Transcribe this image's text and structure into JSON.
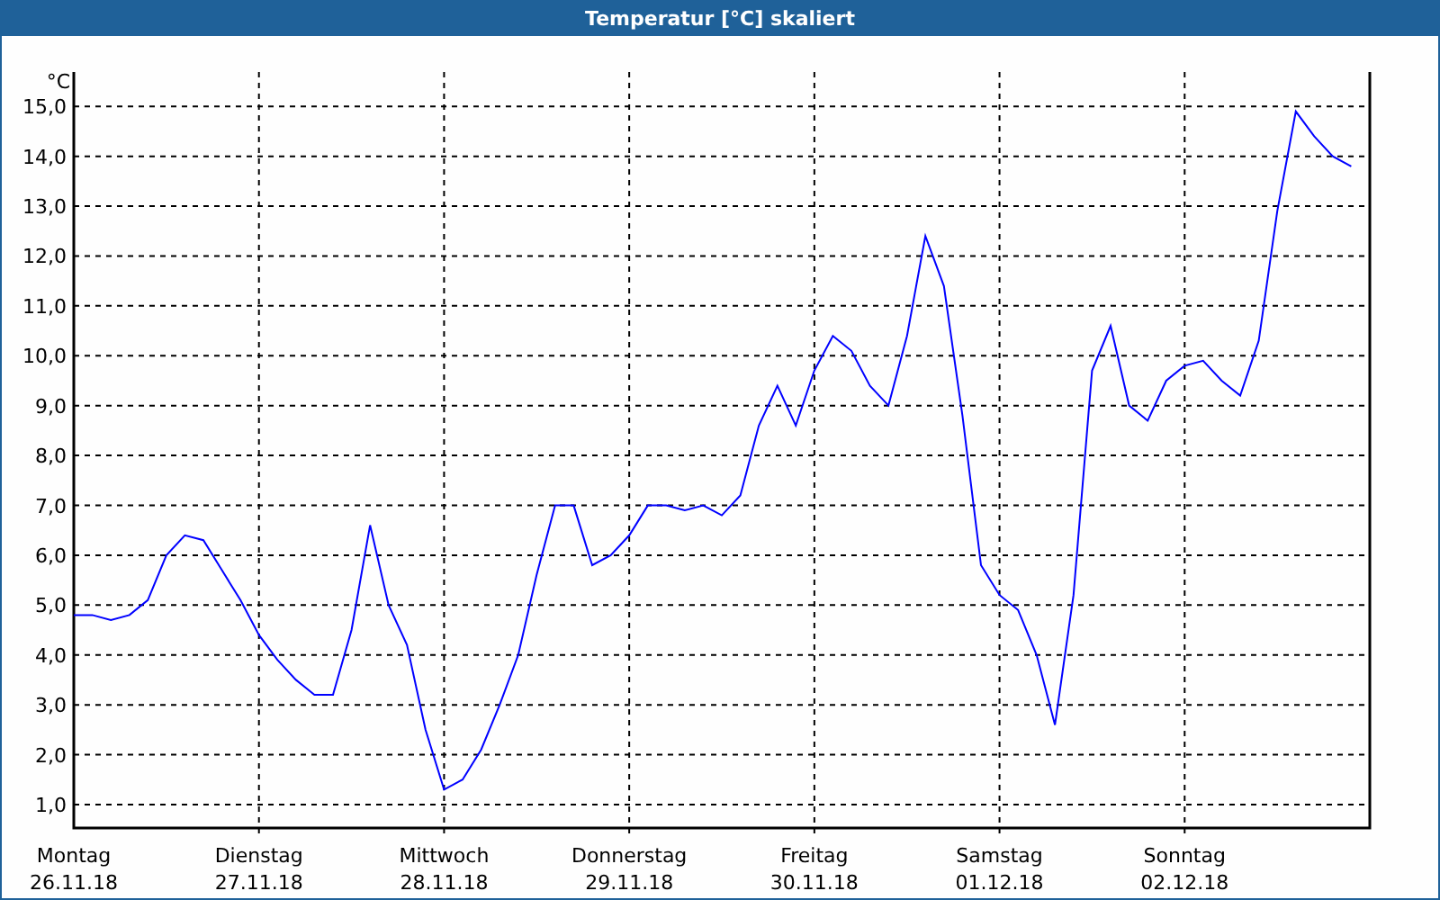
{
  "window": {
    "title": "Temperatur [°C] skaliert"
  },
  "chart": {
    "day_names": [
      "Montag",
      "Dienstag",
      "Mittwoch",
      "Donnerstag",
      "Freitag",
      "Samstag",
      "Sonntag"
    ],
    "chart_data": {
      "type": "line",
      "grid": true,
      "ylabel": "°C",
      "ylim": [
        0.53,
        15.69
      ],
      "yticks": [
        {
          "value": 1,
          "label": "1,0"
        },
        {
          "value": 2,
          "label": "2,0"
        },
        {
          "value": 3,
          "label": "3,0"
        },
        {
          "value": 4,
          "label": "4,0"
        },
        {
          "value": 5,
          "label": "5,0"
        },
        {
          "value": 6,
          "label": "6,0"
        },
        {
          "value": 7,
          "label": "7,0"
        },
        {
          "value": 8,
          "label": "8,0"
        },
        {
          "value": 9,
          "label": "9,0"
        },
        {
          "value": 10,
          "label": "10,0"
        },
        {
          "value": 11,
          "label": "11,0"
        },
        {
          "value": 12,
          "label": "12,0"
        },
        {
          "value": 13,
          "label": "13,0"
        },
        {
          "value": 14,
          "label": "14,0"
        },
        {
          "value": 15,
          "label": "15,0"
        }
      ],
      "categories": [
        "26.11.18",
        null,
        null,
        null,
        null,
        null,
        null,
        null,
        null,
        null,
        "27.11.18",
        null,
        null,
        null,
        null,
        null,
        null,
        null,
        null,
        null,
        "28.11.18",
        null,
        null,
        null,
        null,
        null,
        null,
        null,
        null,
        null,
        "29.11.18",
        null,
        null,
        null,
        null,
        null,
        null,
        null,
        null,
        null,
        "30.11.18",
        null,
        null,
        null,
        null,
        null,
        null,
        null,
        null,
        null,
        "01.12.18",
        null,
        null,
        null,
        null,
        null,
        null,
        null,
        null,
        null,
        "02.12.18",
        null,
        null,
        null,
        null,
        null,
        null,
        null,
        null,
        null
      ],
      "series": [
        {
          "color": "#0000ff",
          "values": [
            4.8,
            4.8,
            4.7,
            4.8,
            5.1,
            6.0,
            6.4,
            6.3,
            5.7,
            5.1,
            4.4,
            3.9,
            3.5,
            3.2,
            3.2,
            4.5,
            6.6,
            5.0,
            4.2,
            2.5,
            1.3,
            1.5,
            2.1,
            3.0,
            4.0,
            5.6,
            7.0,
            7.0,
            5.8,
            6.0,
            6.4,
            7.0,
            7.0,
            6.9,
            7.0,
            6.8,
            7.2,
            8.6,
            9.4,
            8.6,
            9.7,
            10.4,
            10.1,
            9.4,
            9.0,
            10.4,
            12.4,
            11.4,
            8.8,
            5.8,
            5.2,
            4.9,
            4.0,
            2.6,
            5.2,
            9.7,
            10.6,
            9.0,
            8.7,
            9.5,
            9.8,
            9.9,
            9.5,
            9.2,
            10.3,
            12.9,
            14.9,
            14.4,
            14.0,
            13.8
          ]
        }
      ]
    }
  }
}
